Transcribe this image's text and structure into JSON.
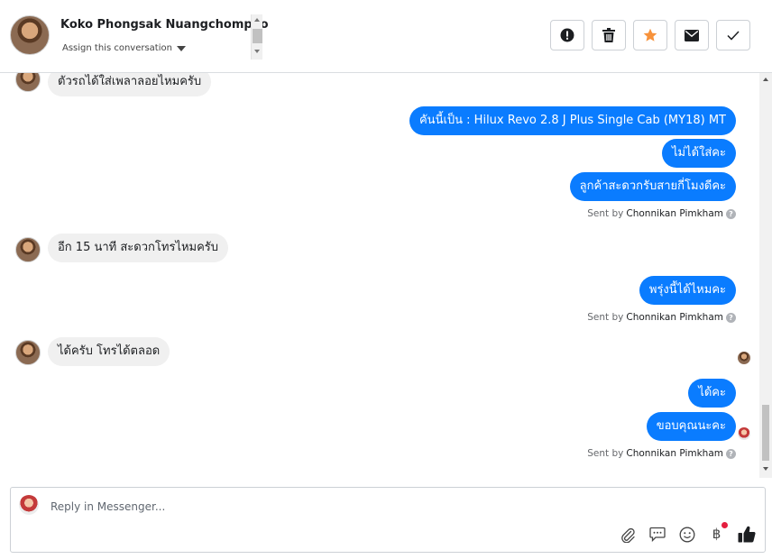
{
  "header": {
    "name": "Koko Phongsak Nuangchompoo",
    "assign_label": "Assign this conversation",
    "actions": [
      {
        "name": "report-button",
        "icon": "exclamation-icon"
      },
      {
        "name": "delete-button",
        "icon": "trash-icon"
      },
      {
        "name": "star-button",
        "icon": "star-icon",
        "color": "#f7923b"
      },
      {
        "name": "mark-unread-button",
        "icon": "envelope-icon"
      },
      {
        "name": "mark-done-button",
        "icon": "check-icon"
      }
    ]
  },
  "messages": [
    {
      "dir": "in",
      "text": "ตัวรถได้ใส่เพลาลอยไหมครับ"
    },
    {
      "dir": "out",
      "text": "คันนี้เป็น : Hilux Revo 2.8 J Plus Single Cab (MY18) MT"
    },
    {
      "dir": "out",
      "text": "ไม่ได้ใส่คะ"
    },
    {
      "dir": "out",
      "text": "ลูกค้าสะดวกรับสายกี่โมงดีคะ"
    },
    {
      "dir": "in",
      "text": "อีก 15 นาที สะดวกโทรไหมครับ"
    },
    {
      "dir": "out",
      "text": "พรุ่งนี้ได้ไหมคะ"
    },
    {
      "dir": "in",
      "text": "ได้ครับ โทรได้ตลอด"
    },
    {
      "dir": "out",
      "text": "ได้คะ"
    },
    {
      "dir": "out",
      "text": "ขอบคุณนะคะ"
    }
  ],
  "sent_by": {
    "prefix": "Sent by",
    "agent": "Chonnikan Pimkham",
    "help": "?"
  },
  "composer": {
    "placeholder": "Reply in Messenger...",
    "tools": [
      "paperclip-icon",
      "speech-bubble-icon",
      "smiley-icon",
      "baht-icon",
      "thumbs-up-icon"
    ],
    "baht_glyph": "฿"
  },
  "colors": {
    "outgoing_bubble": "#0a7cff",
    "incoming_bubble": "#f0f0f0",
    "star": "#f7923b"
  }
}
